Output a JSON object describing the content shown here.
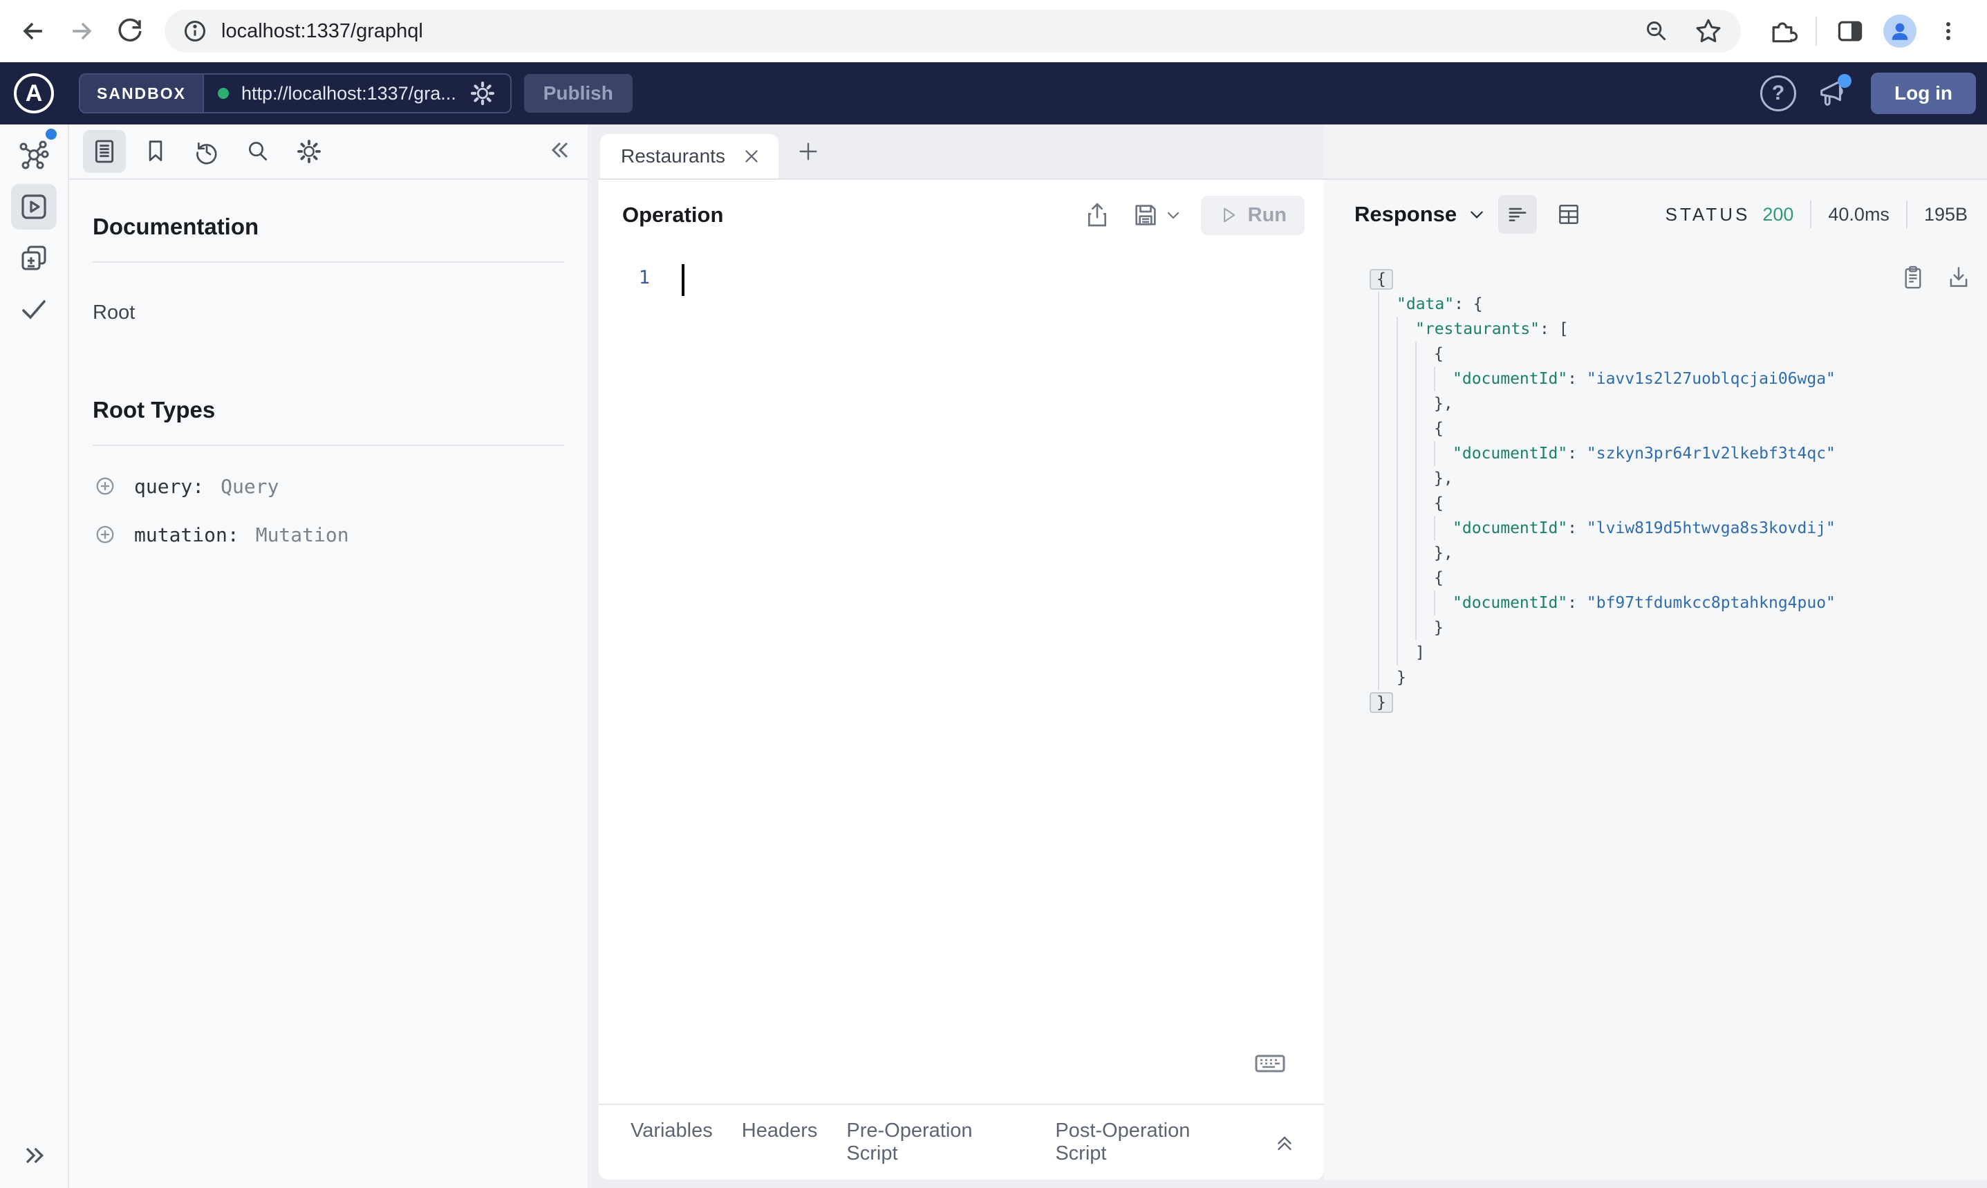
{
  "browser": {
    "url": "localhost:1337/graphql"
  },
  "apollo_header": {
    "brand_letter": "A",
    "env_label": "SANDBOX",
    "endpoint_url": "http://localhost:1337/gra...",
    "publish_label": "Publish",
    "help_glyph": "?",
    "login_label": "Log in"
  },
  "doc_panel": {
    "title": "Documentation",
    "root_label": "Root",
    "root_types_title": "Root Types",
    "root_types": [
      {
        "name": "query",
        "type": "Query"
      },
      {
        "name": "mutation",
        "type": "Mutation"
      }
    ]
  },
  "tab_bar": {
    "active_tab": "Restaurants"
  },
  "operation_panel": {
    "title": "Operation",
    "run_label": "Run",
    "line_number": "1",
    "footer_tabs": [
      "Variables",
      "Headers",
      "Pre-Operation Script",
      "Post-Operation Script"
    ]
  },
  "response_panel": {
    "title": "Response",
    "status_label": "STATUS",
    "status_code": "200",
    "duration": "40.0ms",
    "size": "195B",
    "json_lines": [
      {
        "indent": 0,
        "boxed": true,
        "tokens": [
          [
            "p",
            "{"
          ]
        ]
      },
      {
        "indent": 1,
        "tokens": [
          [
            "k",
            "\"data\""
          ],
          [
            "p",
            ": {"
          ]
        ]
      },
      {
        "indent": 2,
        "tokens": [
          [
            "k",
            "\"restaurants\""
          ],
          [
            "p",
            ": ["
          ]
        ]
      },
      {
        "indent": 3,
        "tokens": [
          [
            "p",
            "{"
          ]
        ]
      },
      {
        "indent": 4,
        "tokens": [
          [
            "k",
            "\"documentId\""
          ],
          [
            "p",
            ": "
          ],
          [
            "v",
            "\"iavv1s2l27uoblqcjai06wga\""
          ]
        ]
      },
      {
        "indent": 3,
        "tokens": [
          [
            "p",
            "},"
          ]
        ]
      },
      {
        "indent": 3,
        "tokens": [
          [
            "p",
            "{"
          ]
        ]
      },
      {
        "indent": 4,
        "tokens": [
          [
            "k",
            "\"documentId\""
          ],
          [
            "p",
            ": "
          ],
          [
            "v",
            "\"szkyn3pr64r1v2lkebf3t4qc\""
          ]
        ]
      },
      {
        "indent": 3,
        "tokens": [
          [
            "p",
            "},"
          ]
        ]
      },
      {
        "indent": 3,
        "tokens": [
          [
            "p",
            "{"
          ]
        ]
      },
      {
        "indent": 4,
        "tokens": [
          [
            "k",
            "\"documentId\""
          ],
          [
            "p",
            ": "
          ],
          [
            "v",
            "\"lviw819d5htwvga8s3kovdij\""
          ]
        ]
      },
      {
        "indent": 3,
        "tokens": [
          [
            "p",
            "},"
          ]
        ]
      },
      {
        "indent": 3,
        "tokens": [
          [
            "p",
            "{"
          ]
        ]
      },
      {
        "indent": 4,
        "tokens": [
          [
            "k",
            "\"documentId\""
          ],
          [
            "p",
            ": "
          ],
          [
            "v",
            "\"bf97tfdumkcc8ptahkng4puo\""
          ]
        ]
      },
      {
        "indent": 3,
        "tokens": [
          [
            "p",
            "}"
          ]
        ]
      },
      {
        "indent": 2,
        "tokens": [
          [
            "p",
            "]"
          ]
        ]
      },
      {
        "indent": 1,
        "tokens": [
          [
            "p",
            "}"
          ]
        ]
      },
      {
        "indent": 0,
        "boxed": true,
        "tokens": [
          [
            "p",
            "}"
          ]
        ]
      }
    ]
  },
  "colors": {
    "header_bg": "#1c2342",
    "status_ok": "#2f9b73",
    "json_key": "#1a8068",
    "json_str": "#2e6cb0",
    "accent": "#2e7de0"
  }
}
